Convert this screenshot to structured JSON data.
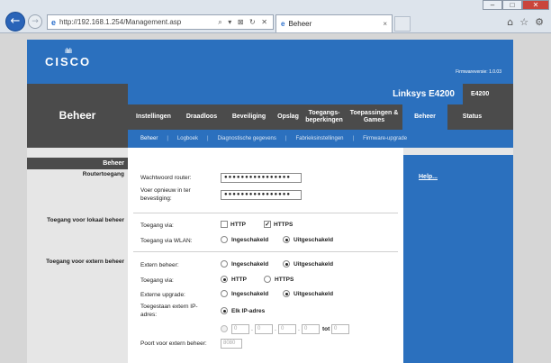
{
  "browser": {
    "url": "http://192.168.1.254/Management.asp",
    "tab_title": "Beheer",
    "tab_close": "×",
    "address_actions": "⌕ ▾ ⊠ ↻ ✕",
    "window_buttons": [
      "–",
      "□",
      "✕"
    ],
    "toolbar_icons": [
      "home-icon",
      "star-icon",
      "gear-icon"
    ]
  },
  "header": {
    "brand": "CISCO",
    "firmware": "Firmwareversie: 1.0.03",
    "product": "Linksys E4200",
    "model": "E4200",
    "page_title": "Beheer"
  },
  "nav": {
    "items": [
      {
        "label": "Instellingen"
      },
      {
        "label": "Draadloos"
      },
      {
        "label": "Beveiliging"
      },
      {
        "label": "Opslag"
      },
      {
        "label": "Toegangs-beperkingen"
      },
      {
        "label": "Toepassingen & Games"
      },
      {
        "label": "Beheer"
      },
      {
        "label": "Status"
      }
    ],
    "active": "Beheer"
  },
  "subnav": {
    "items": [
      "Beheer",
      "Logboek",
      "Diagnostische gegevens",
      "Fabrieksinstellingen",
      "Firmware-upgrade"
    ],
    "separator": "|"
  },
  "left": {
    "section": "Beheer",
    "router_access": "Routertoegang",
    "local_access": "Toegang voor lokaal beheer",
    "remote_access": "Toegang voor extern beheer"
  },
  "form": {
    "password_label": "Wachtwoord router:",
    "password_value": "●●●●●●●●●●●●●●●●",
    "confirm_label_1": "Voer opnieuw in ter",
    "confirm_label_2": "bevestiging:",
    "confirm_value": "●●●●●●●●●●●●●●●●",
    "local_via_label": "Toegang via:",
    "http": "HTTP",
    "https": "HTTPS",
    "check_mark": "✓",
    "wlan_label": "Toegang via WLAN:",
    "enabled": "Ingeschakeld",
    "disabled": "Uitgeschakeld",
    "remote_label": "Extern beheer:",
    "remote_via_label": "Toegang via:",
    "upgrade_label": "Externe upgrade:",
    "allowed_ip_label_1": "Toegestaan extern IP-",
    "allowed_ip_label_2": "adres:",
    "any_ip": "Elk IP-adres",
    "ip_octets": [
      "0",
      "0",
      "0",
      "0",
      "0"
    ],
    "ip_dot": ".",
    "to": "tot",
    "port_label": "Poort voor extern beheer:",
    "port_value": "8080"
  },
  "help": {
    "label": "Help..."
  }
}
